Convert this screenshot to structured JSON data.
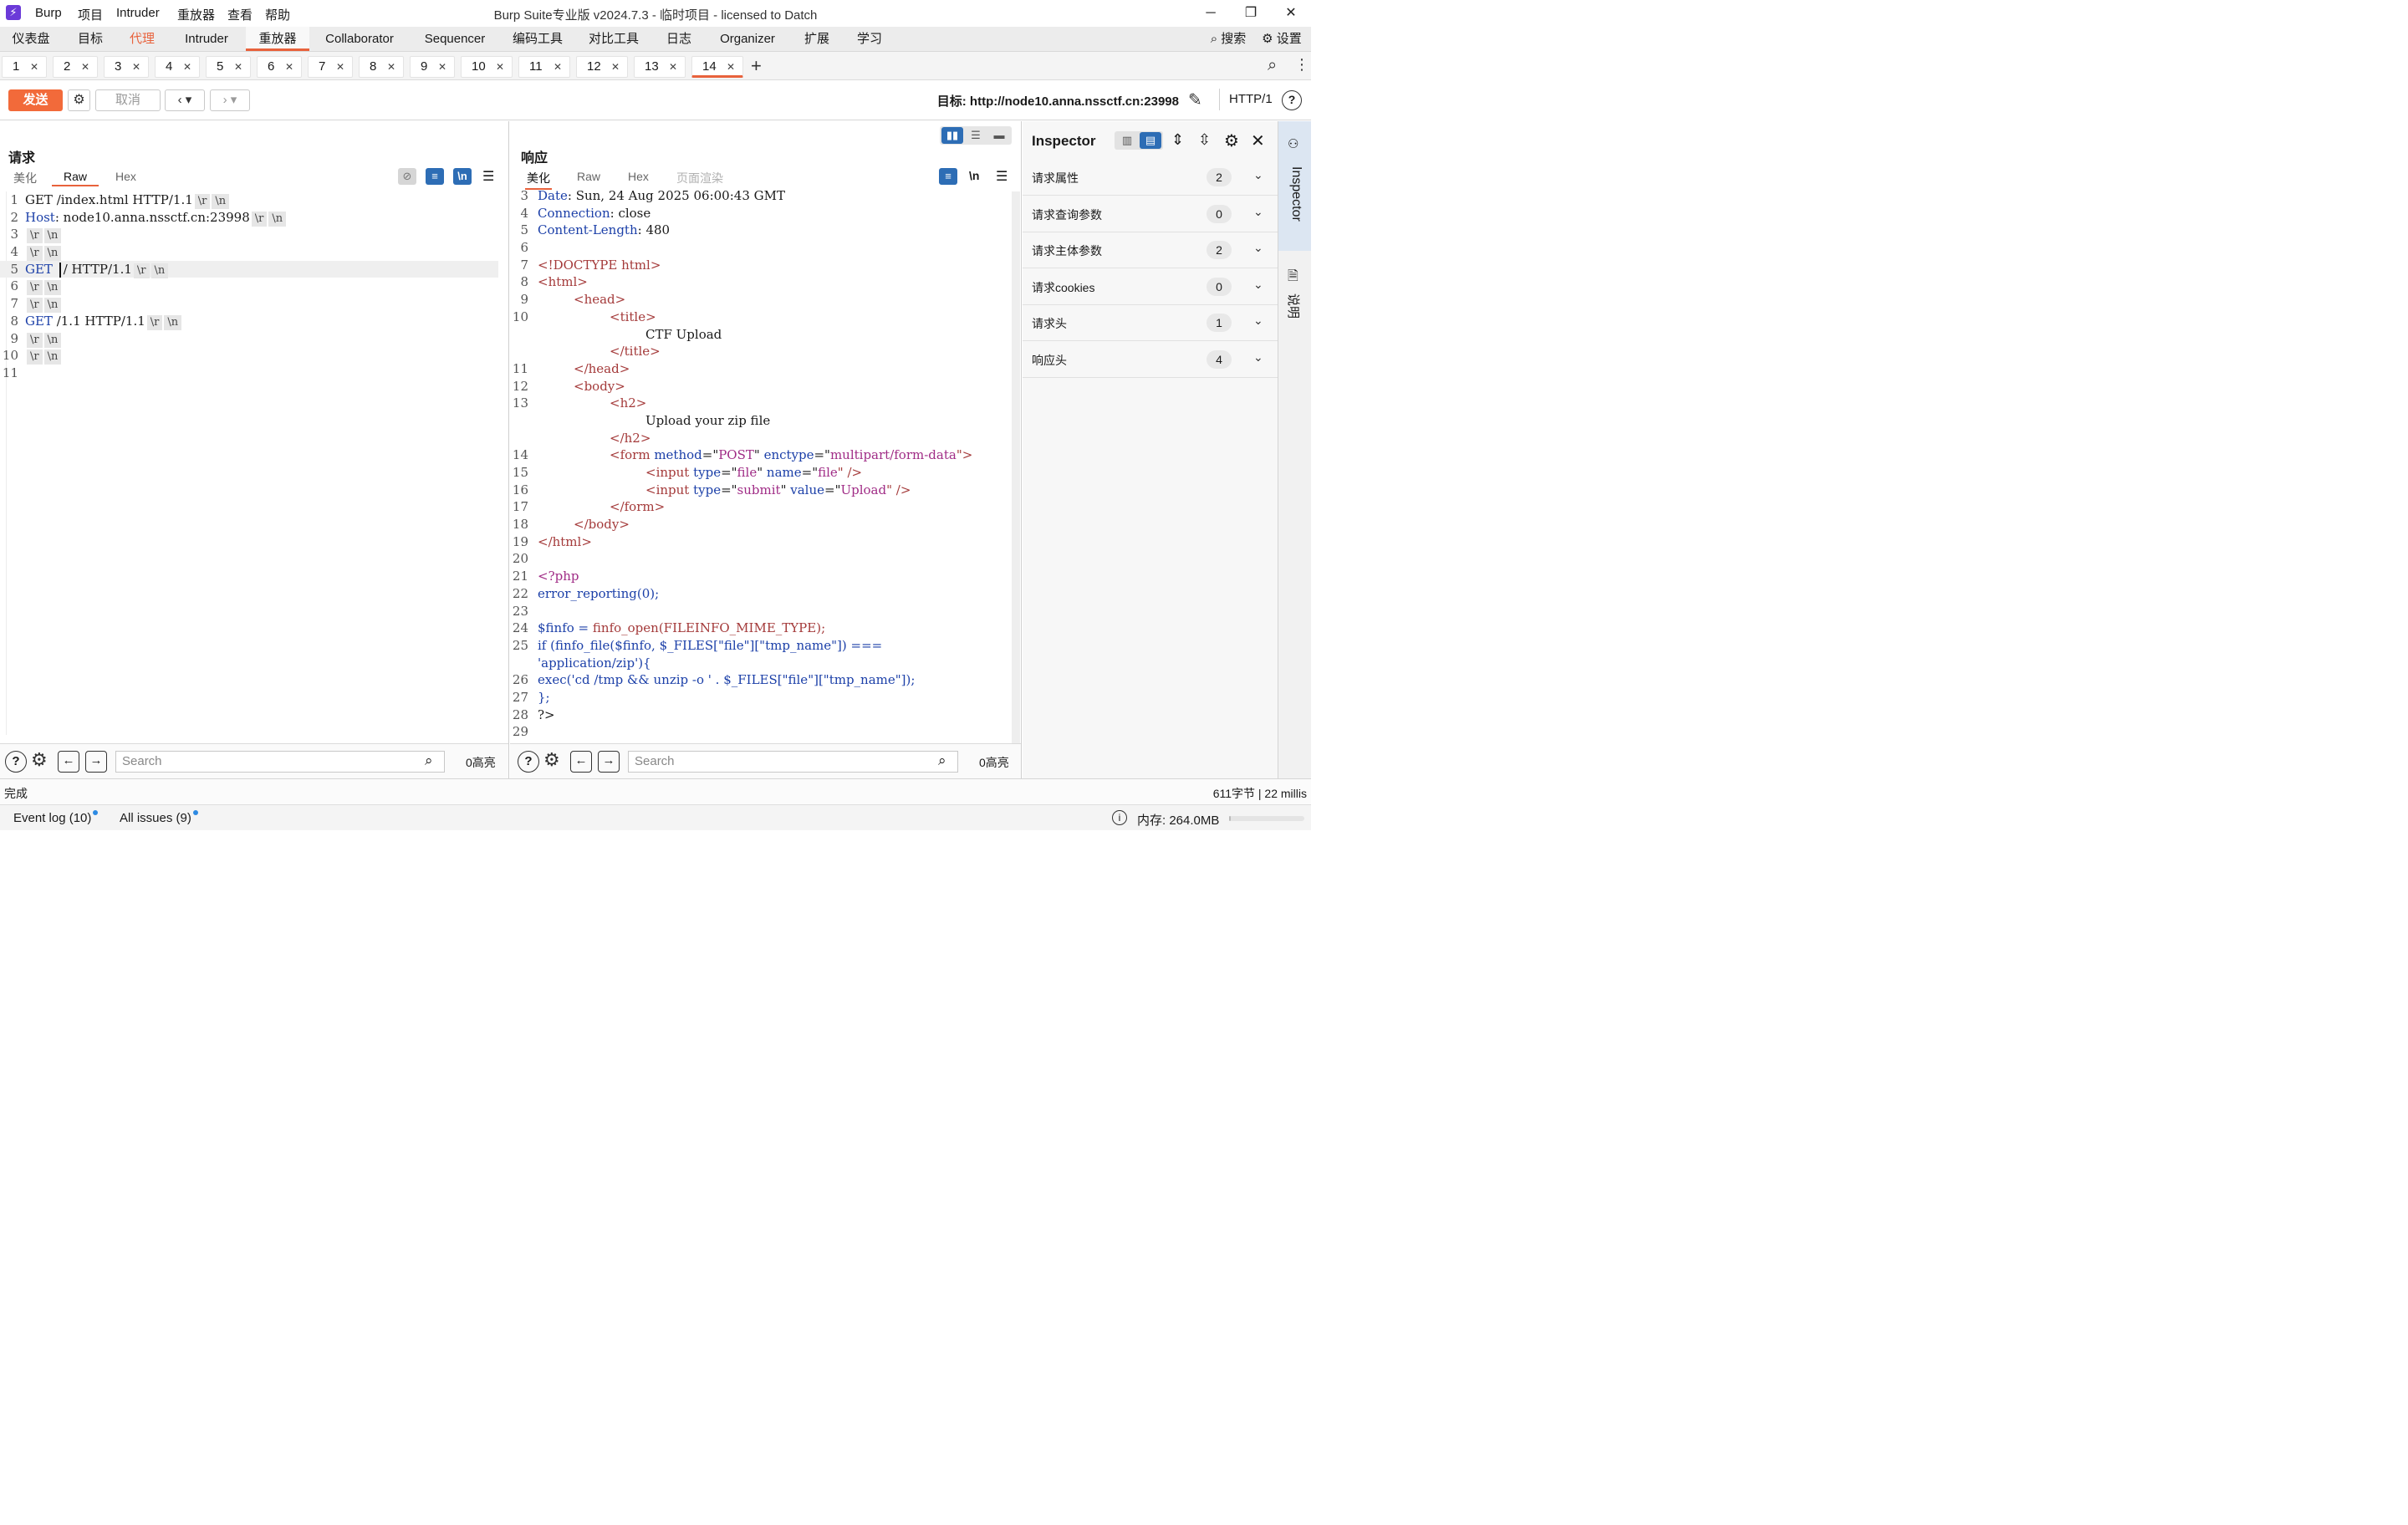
{
  "app": {
    "logo": "⚡",
    "menu": [
      "Burp",
      "项目",
      "Intruder",
      "重放器",
      "查看",
      "帮助"
    ],
    "window_title": "Burp Suite专业版  v2024.7.3 - 临时项目 - licensed to Datch"
  },
  "main_tabs": [
    "仪表盘",
    "目标",
    "代理",
    "Intruder",
    "重放器",
    "Collaborator",
    "Sequencer",
    "编码工具",
    "对比工具",
    "日志",
    "Organizer",
    "扩展",
    "学习"
  ],
  "main_tabs_right": {
    "search": "搜索",
    "settings": "设置"
  },
  "repeater_tabs": [
    "1",
    "2",
    "3",
    "4",
    "5",
    "6",
    "7",
    "8",
    "9",
    "10",
    "11",
    "12",
    "13",
    "14"
  ],
  "toolbar": {
    "send": "发送",
    "cancel": "取消",
    "target_prefix": "目标: ",
    "target_url": "http://node10.anna.nssctf.cn:23998",
    "protocol": "HTTP/1"
  },
  "request": {
    "title": "请求",
    "tabs": [
      "美化",
      "Raw",
      "Hex"
    ],
    "active_tab": "Raw",
    "lines": [
      {
        "n": "1",
        "text": "GET /index.html HTTP/1.1"
      },
      {
        "n": "2",
        "key": "Host",
        "text": ": node10.anna.nssctf.cn:23998"
      },
      {
        "n": "3",
        "text": ""
      },
      {
        "n": "4",
        "text": ""
      },
      {
        "n": "5",
        "method": "GET",
        "text": " / HTTP/1.1"
      },
      {
        "n": "6",
        "text": ""
      },
      {
        "n": "7",
        "text": ""
      },
      {
        "n": "8",
        "method": "GET",
        "text": " /1.1 HTTP/1.1"
      },
      {
        "n": "9",
        "text": ""
      },
      {
        "n": "10",
        "text": ""
      },
      {
        "n": "11",
        "text": ""
      }
    ],
    "crlf_cr": "\\r",
    "crlf_lf": "\\n",
    "search_placeholder": "Search",
    "highlights": "0高亮"
  },
  "response": {
    "title": "响应",
    "tabs": [
      "美化",
      "Raw",
      "Hex",
      "页面渲染"
    ],
    "active_tab": "美化",
    "newline_label": "\\n",
    "lines": [
      {
        "n": "3",
        "parts": [
          [
            "Date",
            "b"
          ],
          [
            ": Sun, 24 Aug 2025 06:00:43 GMT",
            "k"
          ]
        ]
      },
      {
        "n": "4",
        "parts": [
          [
            "Connection",
            "b"
          ],
          [
            ": close",
            "k"
          ]
        ]
      },
      {
        "n": "5",
        "parts": [
          [
            "Content-Length",
            "b"
          ],
          [
            ": 480",
            "k"
          ]
        ]
      },
      {
        "n": "6",
        "parts": []
      },
      {
        "n": "7",
        "parts": [
          [
            "<!DOCTYPE html>",
            "r"
          ]
        ]
      },
      {
        "n": "8",
        "parts": [
          [
            "<",
            "r"
          ],
          [
            "html",
            "r"
          ],
          [
            ">",
            "r"
          ]
        ]
      },
      {
        "n": "9",
        "indent": 1,
        "parts": [
          [
            "<head>",
            "r"
          ]
        ]
      },
      {
        "n": "10",
        "indent": 2,
        "parts": [
          [
            "<title>",
            "r"
          ]
        ]
      },
      {
        "n": "",
        "indent": 3,
        "parts": [
          [
            "CTF Upload",
            "k"
          ]
        ]
      },
      {
        "n": "",
        "indent": 2,
        "parts": [
          [
            "</title>",
            "r"
          ]
        ]
      },
      {
        "n": "11",
        "indent": 1,
        "parts": [
          [
            "</head>",
            "r"
          ]
        ]
      },
      {
        "n": "12",
        "indent": 1,
        "parts": [
          [
            "<body>",
            "r"
          ]
        ]
      },
      {
        "n": "13",
        "indent": 2,
        "parts": [
          [
            "<h2>",
            "r"
          ]
        ]
      },
      {
        "n": "",
        "indent": 3,
        "parts": [
          [
            "Upload your zip file",
            "k"
          ]
        ]
      },
      {
        "n": "",
        "indent": 2,
        "parts": [
          [
            "</h2>",
            "r"
          ]
        ]
      },
      {
        "n": "14",
        "indent": 2,
        "parts": [
          [
            "<form ",
            "r"
          ],
          [
            "method",
            "b"
          ],
          [
            "=\"",
            "k"
          ],
          [
            "POST",
            "p"
          ],
          [
            "\" ",
            "k"
          ],
          [
            "enctype",
            "b"
          ],
          [
            "=\"",
            "k"
          ],
          [
            "multipart/form-data",
            "p"
          ],
          [
            "\">",
            "r"
          ]
        ]
      },
      {
        "n": "15",
        "indent": 3,
        "parts": [
          [
            "<input ",
            "r"
          ],
          [
            "type",
            "b"
          ],
          [
            "=\"",
            "k"
          ],
          [
            "file",
            "p"
          ],
          [
            "\" ",
            "k"
          ],
          [
            "name",
            "b"
          ],
          [
            "=\"",
            "k"
          ],
          [
            "file",
            "p"
          ],
          [
            "\" />",
            "r"
          ]
        ]
      },
      {
        "n": "16",
        "indent": 3,
        "parts": [
          [
            "<input ",
            "r"
          ],
          [
            "type",
            "b"
          ],
          [
            "=\"",
            "k"
          ],
          [
            "submit",
            "p"
          ],
          [
            "\" ",
            "k"
          ],
          [
            "value",
            "b"
          ],
          [
            "=\"",
            "k"
          ],
          [
            "Upload",
            "p"
          ],
          [
            "\" />",
            "r"
          ]
        ]
      },
      {
        "n": "17",
        "indent": 2,
        "parts": [
          [
            "</form>",
            "r"
          ]
        ]
      },
      {
        "n": "18",
        "indent": 1,
        "parts": [
          [
            "</body>",
            "r"
          ]
        ]
      },
      {
        "n": "19",
        "parts": [
          [
            "</html>",
            "r"
          ]
        ]
      },
      {
        "n": "20",
        "parts": []
      },
      {
        "n": "21",
        "parts": [
          [
            "<?php",
            "p"
          ]
        ]
      },
      {
        "n": "22",
        "parts": [
          [
            "error_reporting(0);",
            "b"
          ]
        ]
      },
      {
        "n": "23",
        "parts": []
      },
      {
        "n": "24",
        "parts": [
          [
            "$finfo = ",
            "b"
          ],
          [
            "finfo_open(FILEINFO_MIME_TYPE);",
            "r"
          ]
        ]
      },
      {
        "n": "25",
        "parts": [
          [
            "if (finfo_file($finfo, $_FILES[\"",
            "b"
          ],
          [
            "file",
            "b"
          ],
          [
            "\"][\"",
            "b"
          ],
          [
            "tmp_name",
            "b"
          ],
          [
            "\"]) ===",
            "b"
          ]
        ]
      },
      {
        "n": "",
        "parts": [
          [
            "'application/zip'){",
            "b"
          ]
        ]
      },
      {
        "n": "26",
        "parts": [
          [
            "exec('cd /tmp && unzip -o ' . $_FILES[\"file\"][\"tmp_name\"]);",
            "b"
          ]
        ]
      },
      {
        "n": "27",
        "parts": [
          [
            "};",
            "b"
          ]
        ]
      },
      {
        "n": "28",
        "parts": [
          [
            "?>",
            "k"
          ]
        ]
      },
      {
        "n": "29",
        "parts": []
      }
    ],
    "search_placeholder": "Search",
    "highlights": "0高亮"
  },
  "inspector": {
    "title": "Inspector",
    "rows": [
      {
        "label": "请求属性",
        "count": "2"
      },
      {
        "label": "请求查询参数",
        "count": "0"
      },
      {
        "label": "请求主体参数",
        "count": "2"
      },
      {
        "label": "请求cookies",
        "count": "0"
      },
      {
        "label": "请求头",
        "count": "1"
      },
      {
        "label": "响应头",
        "count": "4"
      }
    ]
  },
  "side_tabs": [
    "Inspector",
    "说明"
  ],
  "status": {
    "left": "完成",
    "right": "611字节 | 22 millis"
  },
  "bottom": {
    "event_log": "Event log (10)",
    "issues": "All issues (9)",
    "memory": "内存: 264.0MB"
  },
  "colors": {
    "accent": "#e8623c",
    "send": "#f26a3a",
    "blue": "#2d6db5"
  }
}
